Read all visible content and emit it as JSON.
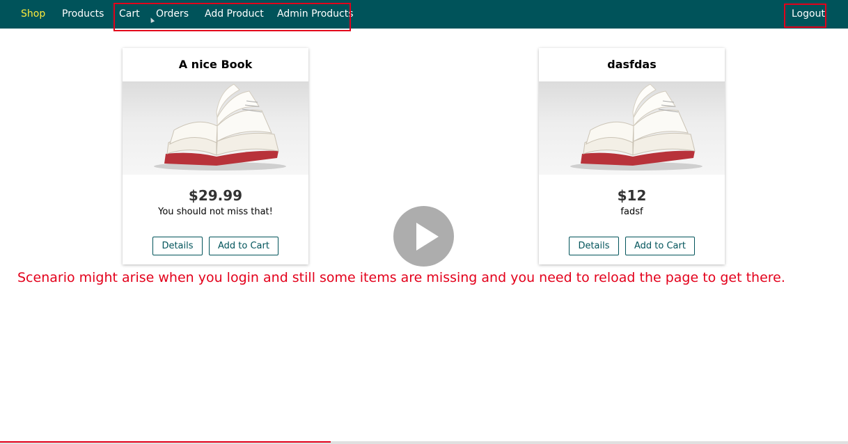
{
  "nav": {
    "shop": "Shop",
    "products": "Products",
    "cart": "Cart",
    "orders": "Orders",
    "add_product": "Add Product",
    "admin_products": "Admin Products",
    "logout": "Logout"
  },
  "products": [
    {
      "title": "A nice Book",
      "price": "$29.99",
      "description": "You should not miss that!",
      "details_label": "Details",
      "add_to_cart_label": "Add to Cart"
    },
    {
      "title": "dasfdas",
      "price": "$12",
      "description": "fadsf",
      "details_label": "Details",
      "add_to_cart_label": "Add to Cart"
    }
  ],
  "video": {
    "caption": "Scenario might arise when you login and still some items are missing and you need to reload the page to get there.",
    "progress": 0.39,
    "icon": "play-icon"
  },
  "colors": {
    "nav_bg": "#00535a",
    "active_link": "#ffeb3b",
    "annotation_red": "#e3001b",
    "button_border": "#00535a"
  }
}
